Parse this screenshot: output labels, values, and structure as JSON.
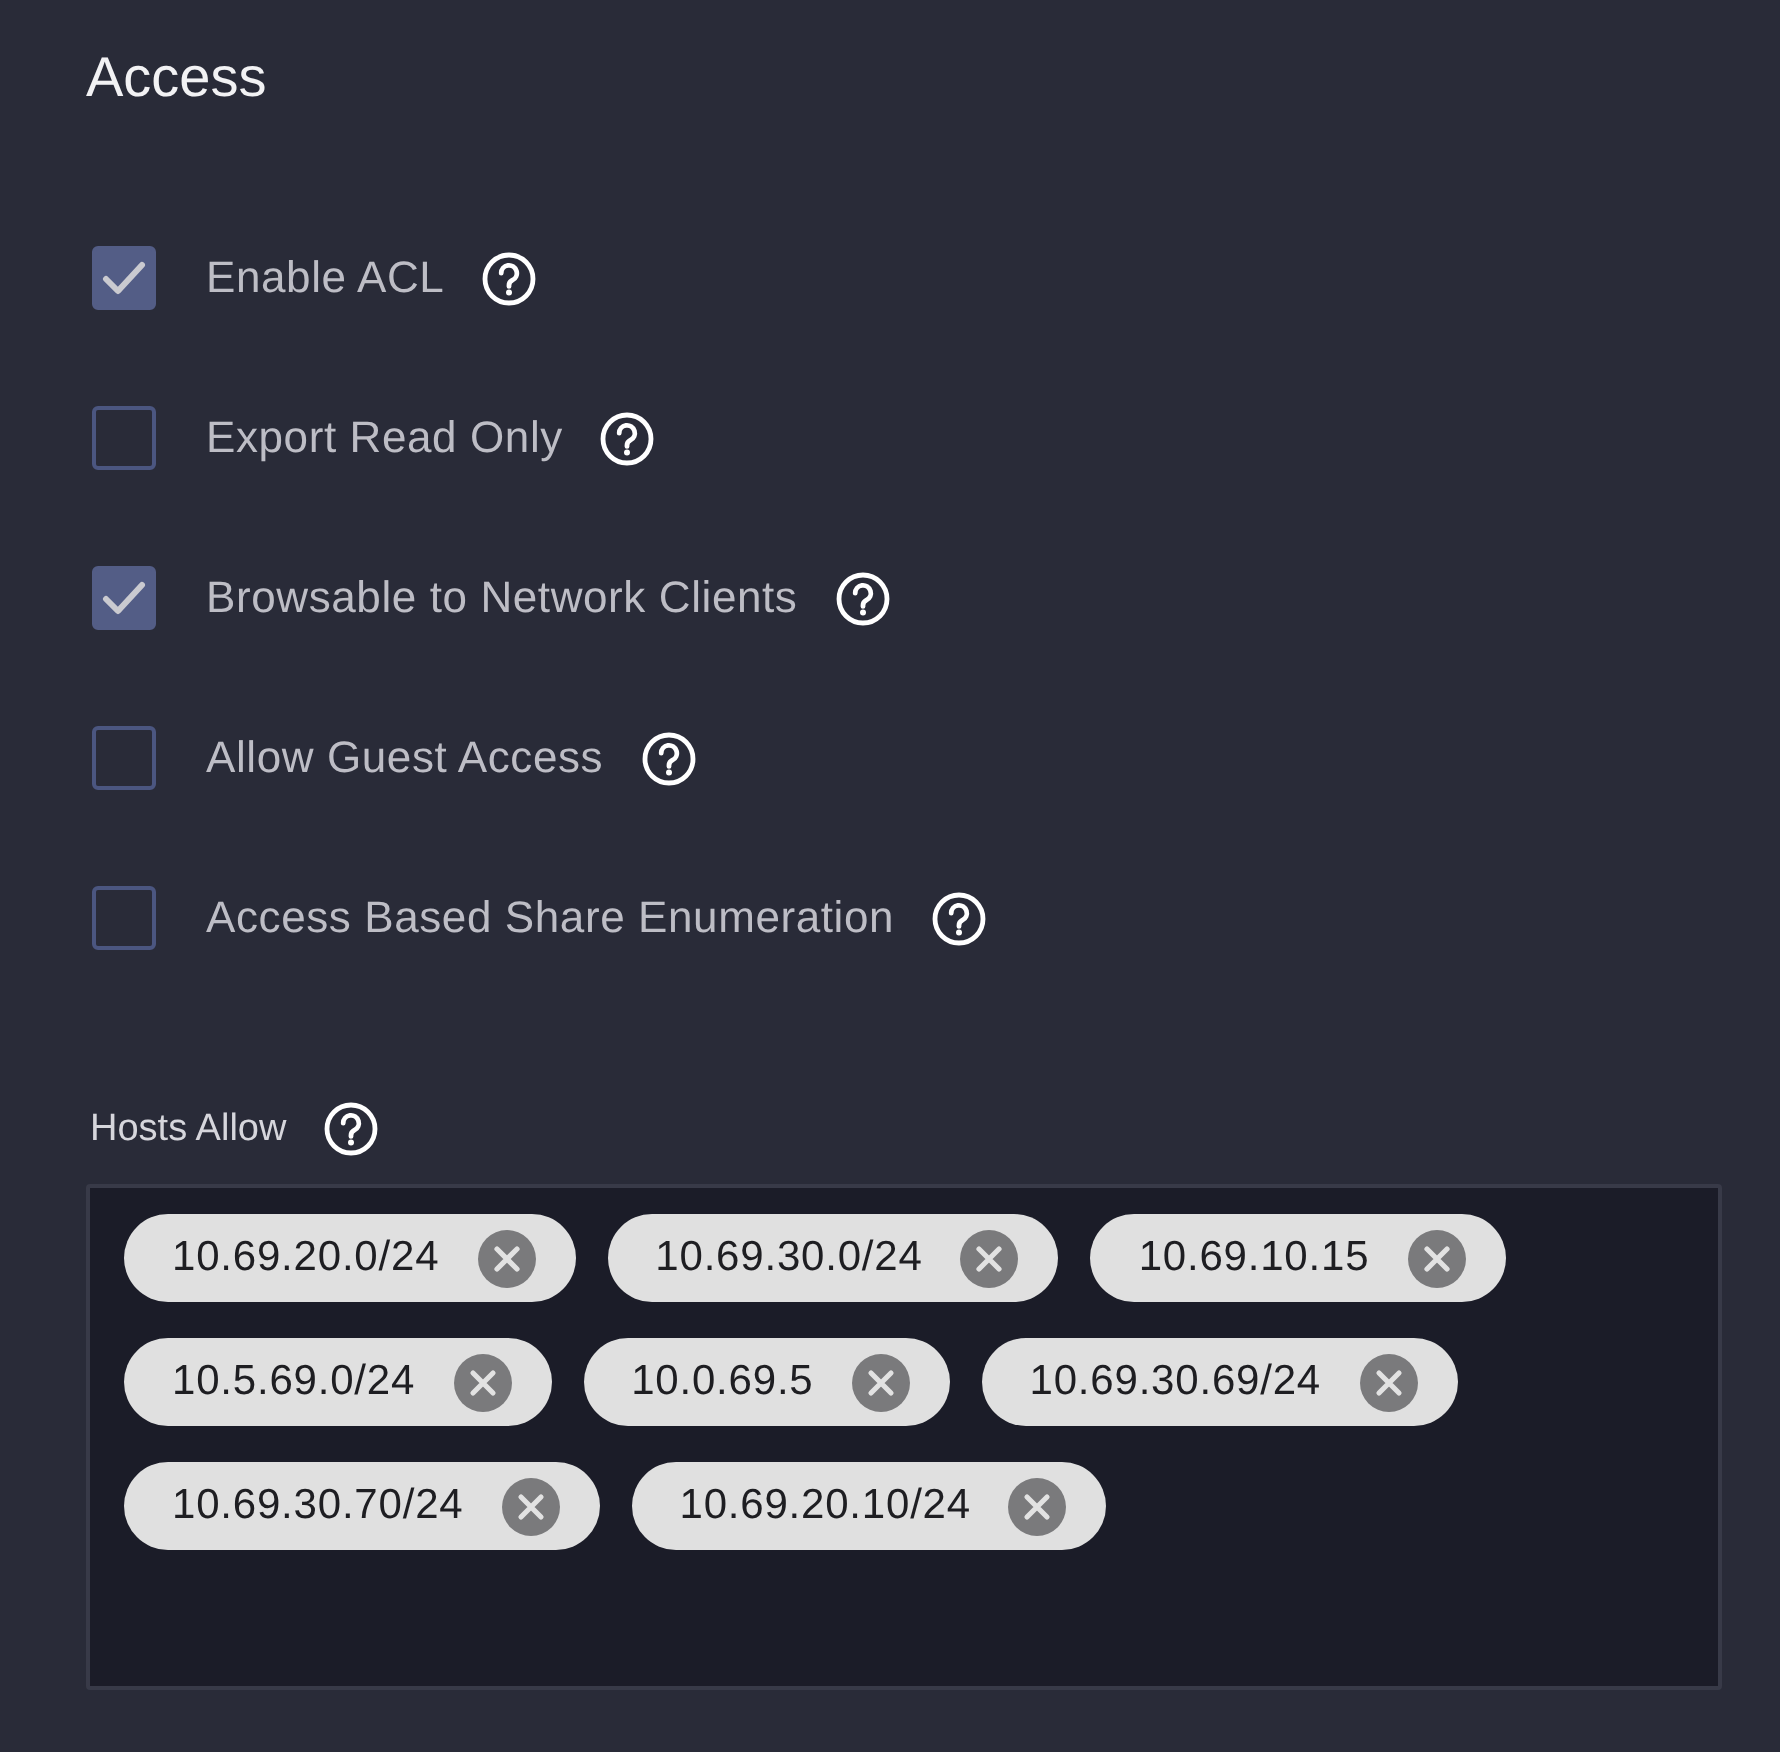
{
  "section": {
    "title": "Access"
  },
  "options": [
    {
      "label": "Enable ACL",
      "checked": true
    },
    {
      "label": "Export Read Only",
      "checked": false
    },
    {
      "label": "Browsable to Network Clients",
      "checked": true
    },
    {
      "label": "Allow Guest Access",
      "checked": false
    },
    {
      "label": "Access Based Share Enumeration",
      "checked": false
    }
  ],
  "hosts_allow": {
    "label": "Hosts Allow",
    "chips": [
      "10.69.20.0/24",
      "10.69.30.0/24",
      "10.69.10.15",
      "10.5.69.0/24",
      "10.0.69.5",
      "10.69.30.69/24",
      "10.69.30.70/24",
      "10.69.20.10/24"
    ]
  }
}
